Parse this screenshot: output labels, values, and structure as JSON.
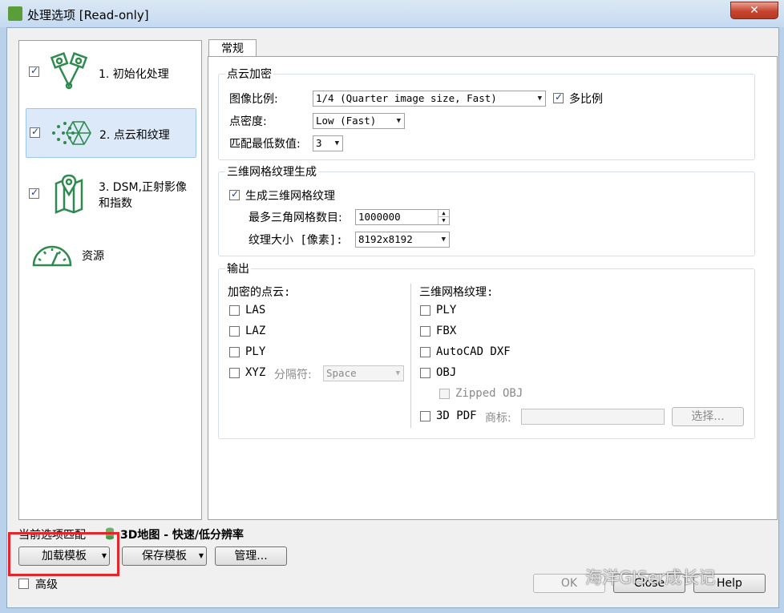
{
  "window": {
    "title": "处理选项 [Read-only]",
    "close_glyph": "✕"
  },
  "nav": {
    "items": [
      {
        "label": "1. 初始化处理",
        "checked": true
      },
      {
        "label": "2. 点云和纹理",
        "checked": true,
        "selected": true
      },
      {
        "label_line1": "3. DSM,正射影像",
        "label_line2": "和指数",
        "checked": true
      },
      {
        "label": "资源"
      }
    ]
  },
  "tab": {
    "label": "常规"
  },
  "densify": {
    "title": "点云加密",
    "image_scale_label": "图像比例:",
    "image_scale_value": "1/4 (Quarter image size, Fast)",
    "multiscale_label": "多比例",
    "multiscale_checked": true,
    "density_label": "点密度:",
    "density_value": "Low (Fast)",
    "min_match_label": "匹配最低数值:",
    "min_match_value": "3"
  },
  "mesh": {
    "title": "三维网格纹理生成",
    "generate_label": "生成三维网格纹理",
    "generate_checked": true,
    "max_triangles_label": "最多三角网格数目:",
    "max_triangles_value": "1000000",
    "texture_size_label": "纹理大小 [像素]:",
    "texture_size_value": "8192x8192"
  },
  "output": {
    "title": "输出",
    "pointcloud_header": "加密的点云:",
    "pointcloud_items": [
      "LAS",
      "LAZ",
      "PLY",
      "XYZ"
    ],
    "delimiter_label": "分隔符:",
    "delimiter_value": "Space",
    "mesh_header": "三维网格纹理:",
    "mesh_items": [
      "PLY",
      "FBX",
      "AutoCAD DXF",
      "OBJ"
    ],
    "zipped_obj_label": "Zipped OBJ",
    "pdf3d_label": "3D PDF",
    "logo_label": "商标:",
    "choose_label": "选择..."
  },
  "footer": {
    "current_template_label": "当前选项匹配",
    "current_template_value": "3D地图 - 快速/低分辨率",
    "load_template": "加载模板",
    "save_template": "保存模板",
    "manage": "管理...",
    "advanced_label": "高级",
    "ok": "OK",
    "close": "Close",
    "help": "Help"
  },
  "watermark": "海洋GISer成长记",
  "colors": {
    "icon_green": "#2e8a4e",
    "highlight_red": "#e8242a",
    "selected_bg": "#dbe9f9"
  }
}
